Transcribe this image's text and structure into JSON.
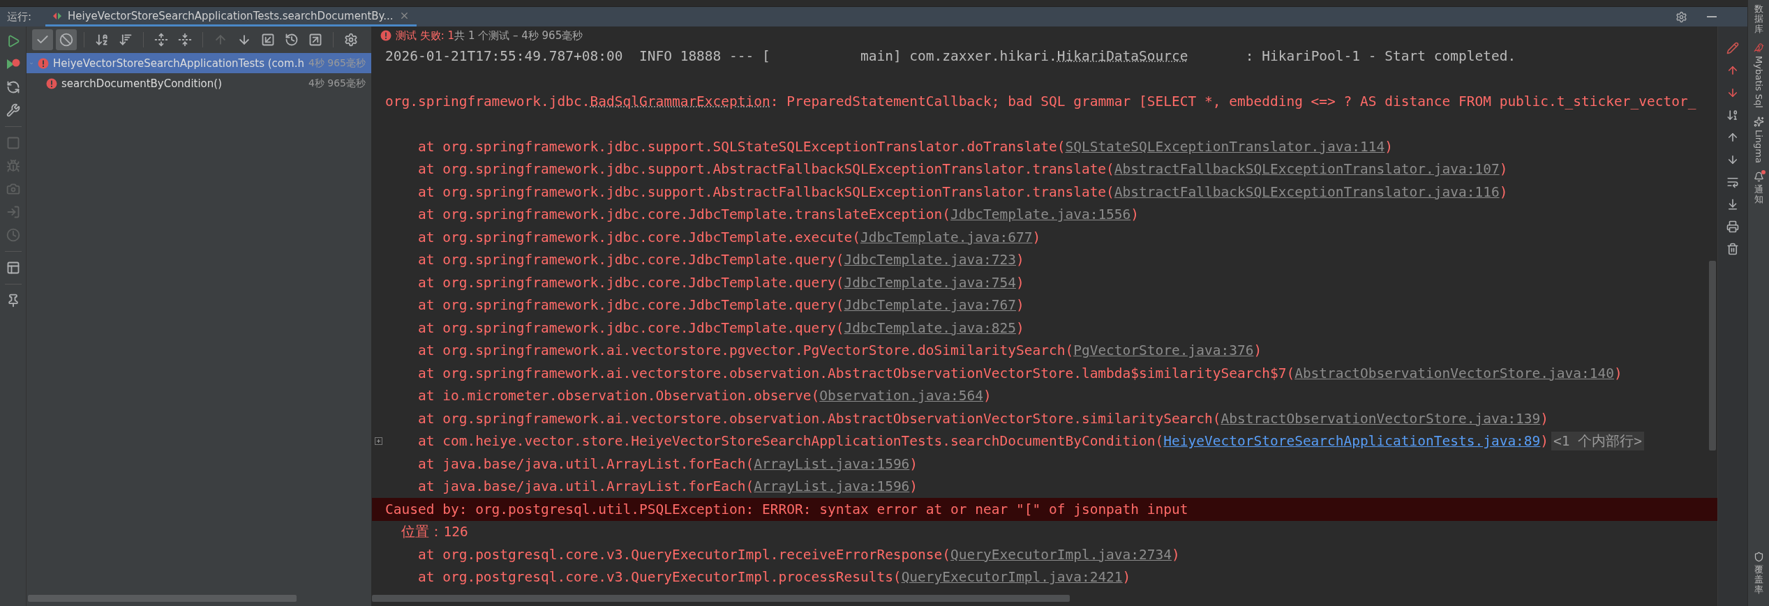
{
  "run_bar": {
    "label": "运行:",
    "tab": {
      "title": "HeiyeVectorStoreSearchApplicationTests.searchDocumentBy...",
      "selected": true
    }
  },
  "side_toolbar": [
    [
      {
        "kind": "run",
        "disabled": false
      },
      {
        "kind": "rerun-failed",
        "disabled": false
      },
      {
        "kind": "rerun",
        "disabled": false
      },
      {
        "kind": "wrench",
        "disabled": false
      }
    ],
    [
      {
        "kind": "stop",
        "disabled": true
      },
      {
        "kind": "debug",
        "disabled": true
      },
      {
        "kind": "camera",
        "disabled": true
      },
      {
        "kind": "import",
        "disabled": true
      },
      {
        "kind": "clock",
        "disabled": true
      }
    ],
    [
      {
        "kind": "layout",
        "disabled": false
      }
    ],
    [
      {
        "kind": "pin",
        "disabled": false
      }
    ]
  ],
  "test_toolbar": [
    [
      {
        "kind": "passed",
        "on": true,
        "disabled": false
      },
      {
        "kind": "ignored",
        "on": true,
        "disabled": false
      }
    ],
    [
      {
        "kind": "sort-alpha",
        "on": false,
        "disabled": false
      },
      {
        "kind": "sort-duration",
        "on": false,
        "disabled": false
      }
    ],
    [
      {
        "kind": "expand",
        "on": false,
        "disabled": false
      },
      {
        "kind": "collapse",
        "on": false,
        "disabled": false
      }
    ],
    [
      {
        "kind": "up",
        "on": false,
        "disabled": true
      },
      {
        "kind": "down",
        "on": false,
        "disabled": false
      },
      {
        "kind": "import",
        "on": false,
        "disabled": false
      },
      {
        "kind": "history",
        "on": false,
        "disabled": false
      },
      {
        "kind": "export",
        "on": false,
        "disabled": false
      }
    ],
    [
      {
        "kind": "settings",
        "on": false,
        "disabled": false
      }
    ]
  ],
  "test_tree": [
    {
      "label": "HeiyeVectorStoreSearchApplicationTests (com.h",
      "time": "4秒 965毫秒",
      "failed": true,
      "expanded": true,
      "selected": true,
      "children": [
        {
          "label": "searchDocumentByCondition()",
          "time": "4秒 965毫秒",
          "failed": true,
          "selected": false
        }
      ]
    }
  ],
  "status": {
    "failed": "测试 失败: 1",
    "summary": "共 1 个测试 – 4秒 965毫秒"
  },
  "console": {
    "lines": [
      {
        "kind": "log",
        "before": "2026-01-21T17:55:49.787+08:00  INFO 18888 --- [           main] com.zaxxer.hikari.",
        "class_name": "HikariDataSource",
        "after": "       : HikariPool-1 - Start completed."
      },
      {
        "kind": "blank"
      },
      {
        "kind": "error",
        "before": "org.springframework.jdbc.",
        "class_name": "BadSqlGrammarException",
        "after": ": PreparedStatementCallback; bad SQL grammar [SELECT *, embedding <=> ? AS distance FROM public.t_sticker_vector_"
      },
      {
        "kind": "blank"
      },
      {
        "kind": "frame",
        "call": "at org.springframework.jdbc.support.SQLStateSQLExceptionTranslator.doTranslate(",
        "source": "SQLStateSQLExceptionTranslator.java:114",
        "close": ")",
        "in_project": false
      },
      {
        "kind": "frame",
        "call": "at org.springframework.jdbc.support.AbstractFallbackSQLExceptionTranslator.translate(",
        "source": "AbstractFallbackSQLExceptionTranslator.java:107",
        "close": ")",
        "in_project": false
      },
      {
        "kind": "frame",
        "call": "at org.springframework.jdbc.support.AbstractFallbackSQLExceptionTranslator.translate(",
        "source": "AbstractFallbackSQLExceptionTranslator.java:116",
        "close": ")",
        "in_project": false
      },
      {
        "kind": "frame",
        "call": "at org.springframework.jdbc.core.JdbcTemplate.translateException(",
        "source": "JdbcTemplate.java:1556",
        "close": ")",
        "in_project": false
      },
      {
        "kind": "frame",
        "call": "at org.springframework.jdbc.core.JdbcTemplate.execute(",
        "source": "JdbcTemplate.java:677",
        "close": ")",
        "in_project": false
      },
      {
        "kind": "frame",
        "call": "at org.springframework.jdbc.core.JdbcTemplate.query(",
        "source": "JdbcTemplate.java:723",
        "close": ")",
        "in_project": false
      },
      {
        "kind": "frame",
        "call": "at org.springframework.jdbc.core.JdbcTemplate.query(",
        "source": "JdbcTemplate.java:754",
        "close": ")",
        "in_project": false
      },
      {
        "kind": "frame",
        "call": "at org.springframework.jdbc.core.JdbcTemplate.query(",
        "source": "JdbcTemplate.java:767",
        "close": ")",
        "in_project": false
      },
      {
        "kind": "frame",
        "call": "at org.springframework.jdbc.core.JdbcTemplate.query(",
        "source": "JdbcTemplate.java:825",
        "close": ")",
        "in_project": false
      },
      {
        "kind": "frame",
        "call": "at org.springframework.ai.vectorstore.pgvector.PgVectorStore.doSimilaritySearch(",
        "source": "PgVectorStore.java:376",
        "close": ")",
        "in_project": false
      },
      {
        "kind": "frame",
        "call": "at org.springframework.ai.vectorstore.observation.AbstractObservationVectorStore.lambda$similaritySearch$7(",
        "source": "AbstractObservationVectorStore.java:140",
        "close": ")",
        "in_project": false
      },
      {
        "kind": "frame",
        "call": "at io.micrometer.observation.Observation.observe(",
        "source": "Observation.java:564",
        "close": ")",
        "in_project": false
      },
      {
        "kind": "frame",
        "call": "at org.springframework.ai.vectorstore.observation.AbstractObservationVectorStore.similaritySearch(",
        "source": "AbstractObservationVectorStore.java:139",
        "close": ")",
        "in_project": false
      },
      {
        "kind": "frame",
        "call": "at com.heiye.vector.store.HeiyeVectorStoreSearchApplicationTests.searchDocumentByCondition(",
        "source": "HeiyeVectorStoreSearchApplicationTests.java:89",
        "close": ")",
        "in_project": true,
        "collapsed_note": "<1 个内部行>"
      },
      {
        "kind": "frame",
        "call": "at java.base/java.util.ArrayList.forEach(",
        "source": "ArrayList.java:1596",
        "close": ")",
        "in_project": false
      },
      {
        "kind": "frame",
        "call": "at java.base/java.util.ArrayList.forEach(",
        "source": "ArrayList.java:1596",
        "close": ")",
        "in_project": false
      },
      {
        "kind": "caused",
        "text": "Caused by: org.postgresql.util.PSQLException: ERROR: syntax error at or near \"[\" of jsonpath input"
      },
      {
        "kind": "detail",
        "text": "位置：126"
      },
      {
        "kind": "frame",
        "call": "at org.postgresql.core.v3.QueryExecutorImpl.receiveErrorResponse(",
        "source": "QueryExecutorImpl.java:2734",
        "close": ")",
        "in_project": false
      },
      {
        "kind": "frame",
        "call": "at org.postgresql.core.v3.QueryExecutorImpl.processResults(",
        "source": "QueryExecutorImpl.java:2421",
        "close": ")",
        "in_project": false
      }
    ]
  },
  "console_toolbar": [
    {
      "kind": "edit",
      "disabled": false
    },
    {
      "kind": "prev-error",
      "disabled": false
    },
    {
      "kind": "next-error",
      "disabled": false
    },
    {
      "kind": "sort",
      "disabled": false
    },
    {
      "kind": "up",
      "disabled": false
    },
    {
      "kind": "down",
      "disabled": false
    },
    {
      "kind": "wrap",
      "disabled": false
    },
    {
      "kind": "scroll-end",
      "disabled": false
    },
    {
      "kind": "print",
      "disabled": false
    },
    {
      "kind": "clear",
      "disabled": false
    }
  ],
  "tool_strip": [
    {
      "kind": "database",
      "label": "数据库",
      "alert": false
    },
    {
      "kind": "mybatis",
      "label": "Mybatis Sql",
      "alert": false
    },
    {
      "kind": "lingma",
      "label": "Lingma",
      "alert": false
    },
    {
      "kind": "notifications",
      "label": "通知",
      "alert": true
    },
    {
      "kind": "coverage",
      "label": "覆盖率",
      "alert": false
    }
  ]
}
